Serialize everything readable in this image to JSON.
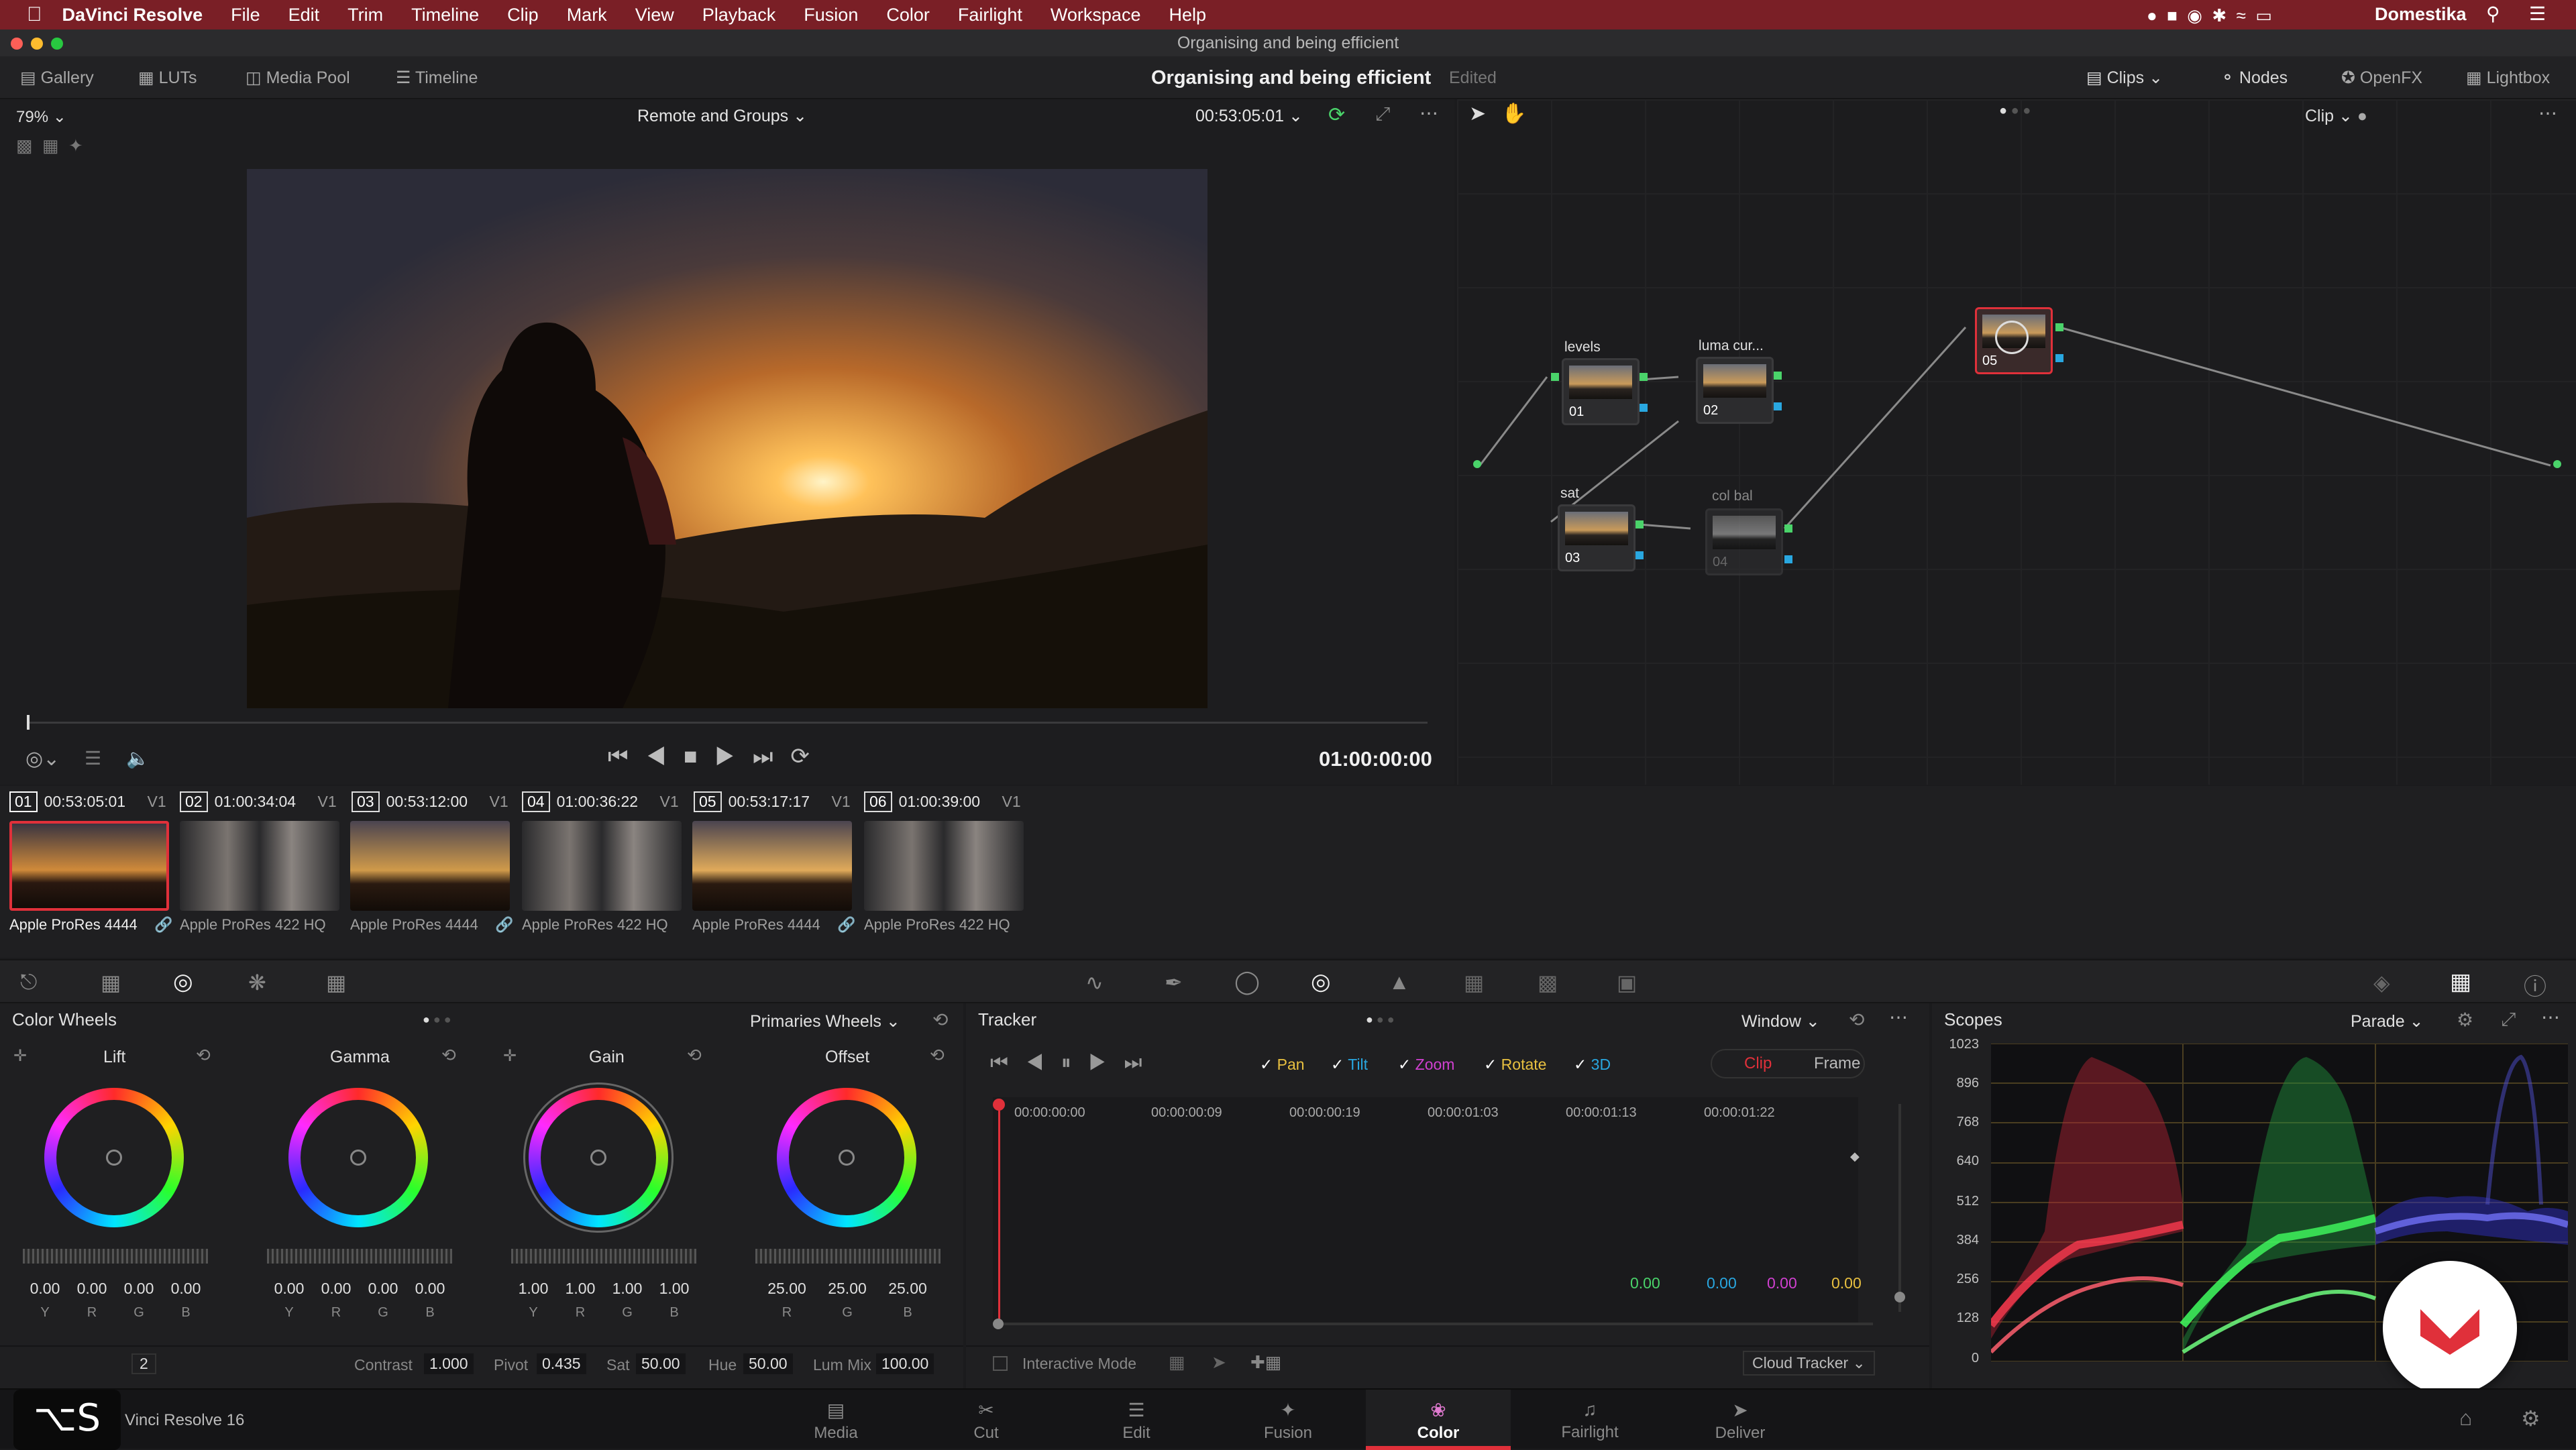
{
  "menubar": {
    "app": "DaVinci Resolve",
    "items": [
      "File",
      "Edit",
      "Trim",
      "Timeline",
      "Clip",
      "Mark",
      "View",
      "Playback",
      "Fusion",
      "Color",
      "Fairlight",
      "Workspace",
      "Help"
    ],
    "user": "Domestika"
  },
  "window": {
    "title": "Organising and being efficient"
  },
  "topbar": {
    "gallery": "Gallery",
    "luts": "LUTs",
    "media_pool": "Media Pool",
    "timeline": "Timeline",
    "project": "Organising and being efficient",
    "status": "Edited",
    "clips": "Clips",
    "nodes": "Nodes",
    "openfx": "OpenFX",
    "lightbox": "Lightbox"
  },
  "viewer": {
    "zoom": "79%",
    "timeline_name": "Remote and Groups",
    "timecode_top": "00:53:05:01",
    "timecode": "01:00:00:00"
  },
  "nodes_panel": {
    "mode": "Clip",
    "nodes": [
      {
        "label": "levels",
        "id": "01"
      },
      {
        "label": "luma cur...",
        "id": "02"
      },
      {
        "label": "sat",
        "id": "03"
      },
      {
        "label": "col bal",
        "id": "04"
      },
      {
        "label": "",
        "id": "05"
      }
    ]
  },
  "clips": [
    {
      "num": "01",
      "tc": "00:53:05:01",
      "track": "V1",
      "codec": "Apple ProRes 4444"
    },
    {
      "num": "02",
      "tc": "01:00:34:04",
      "track": "V1",
      "codec": "Apple ProRes 422 HQ"
    },
    {
      "num": "03",
      "tc": "00:53:12:00",
      "track": "V1",
      "codec": "Apple ProRes 4444"
    },
    {
      "num": "04",
      "tc": "01:00:36:22",
      "track": "V1",
      "codec": "Apple ProRes 422 HQ"
    },
    {
      "num": "05",
      "tc": "00:53:17:17",
      "track": "V1",
      "codec": "Apple ProRes 4444"
    },
    {
      "num": "06",
      "tc": "01:00:39:00",
      "track": "V1",
      "codec": "Apple ProRes 422 HQ"
    }
  ],
  "color_wheels": {
    "title": "Color Wheels",
    "mode": "Primaries Wheels",
    "wheels": [
      {
        "name": "Lift",
        "values": [
          "0.00",
          "0.00",
          "0.00",
          "0.00"
        ],
        "labels": [
          "Y",
          "R",
          "G",
          "B"
        ]
      },
      {
        "name": "Gamma",
        "values": [
          "0.00",
          "0.00",
          "0.00",
          "0.00"
        ],
        "labels": [
          "Y",
          "R",
          "G",
          "B"
        ]
      },
      {
        "name": "Gain",
        "values": [
          "1.00",
          "1.00",
          "1.00",
          "1.00"
        ],
        "labels": [
          "Y",
          "R",
          "G",
          "B"
        ]
      },
      {
        "name": "Offset",
        "values": [
          "25.00",
          "25.00",
          "25.00"
        ],
        "labels": [
          "R",
          "G",
          "B"
        ]
      }
    ],
    "page_num": "2",
    "params": {
      "contrast_label": "Contrast",
      "contrast": "1.000",
      "pivot_label": "Pivot",
      "pivot": "0.435",
      "sat_label": "Sat",
      "sat": "50.00",
      "hue_label": "Hue",
      "hue": "50.00",
      "lummix_label": "Lum Mix",
      "lummix": "100.00"
    }
  },
  "tracker": {
    "title": "Tracker",
    "mode": "Window",
    "checks": [
      "Pan",
      "Tilt",
      "Zoom",
      "Rotate",
      "3D"
    ],
    "clip": "Clip",
    "frame": "Frame",
    "ticks": [
      "00:00:00:00",
      "00:00:00:09",
      "00:00:00:19",
      "00:00:01:03",
      "00:00:01:13",
      "00:00:01:22"
    ],
    "values": [
      "0.00",
      "0.00",
      "0.00",
      "0.00"
    ],
    "interactive": "Interactive Mode",
    "cloud": "Cloud Tracker"
  },
  "scopes": {
    "title": "Scopes",
    "mode": "Parade",
    "labels": [
      "1023",
      "896",
      "768",
      "640",
      "512",
      "384",
      "256",
      "128",
      "0"
    ]
  },
  "pages": [
    "Media",
    "Cut",
    "Edit",
    "Fusion",
    "Color",
    "Fairlight",
    "Deliver"
  ],
  "footer": {
    "app_name": "Vinci Resolve 16"
  },
  "colors": {
    "accent_red": "#e0303a",
    "menubar": "#7a1f26"
  }
}
